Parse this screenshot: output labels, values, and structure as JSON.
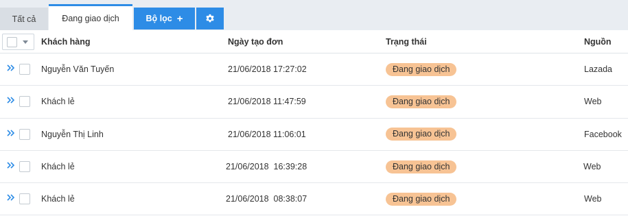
{
  "tabs": {
    "all_label": "Tất cả",
    "active_label": "Đang giao dịch",
    "filter_label": "Bộ lọc",
    "filter_icon": "plus-icon",
    "settings_icon": "gear-icon"
  },
  "colors": {
    "accent": "#2d8ce6",
    "badge_bg": "#f7c394",
    "tabbar_bg": "#e9edf2"
  },
  "table": {
    "headers": {
      "customer": "Khách hàng",
      "created": "Ngày tạo đơn",
      "status": "Trạng thái",
      "source": "Nguồn"
    },
    "rows": [
      {
        "customer": "Nguyễn Văn Tuyến",
        "created": "21/06/2018 17:27:02",
        "status": "Đang giao dịch",
        "source": "Lazada"
      },
      {
        "customer": "Khách lẻ",
        "created": "21/06/2018 11:47:59",
        "status": "Đang giao dịch",
        "source": "Web"
      },
      {
        "customer": "Nguyễn Thị Linh",
        "created": "21/06/2018 11:06:01",
        "status": "Đang giao dịch",
        "source": "Facebook"
      },
      {
        "customer": "Khách lẻ",
        "created": "21/06/2018  16:39:28",
        "status": "Đang giao dịch",
        "source": "Web"
      },
      {
        "customer": "Khách lẻ",
        "created": "21/06/2018  08:38:07",
        "status": "Đang giao dịch",
        "source": "Web"
      }
    ]
  }
}
